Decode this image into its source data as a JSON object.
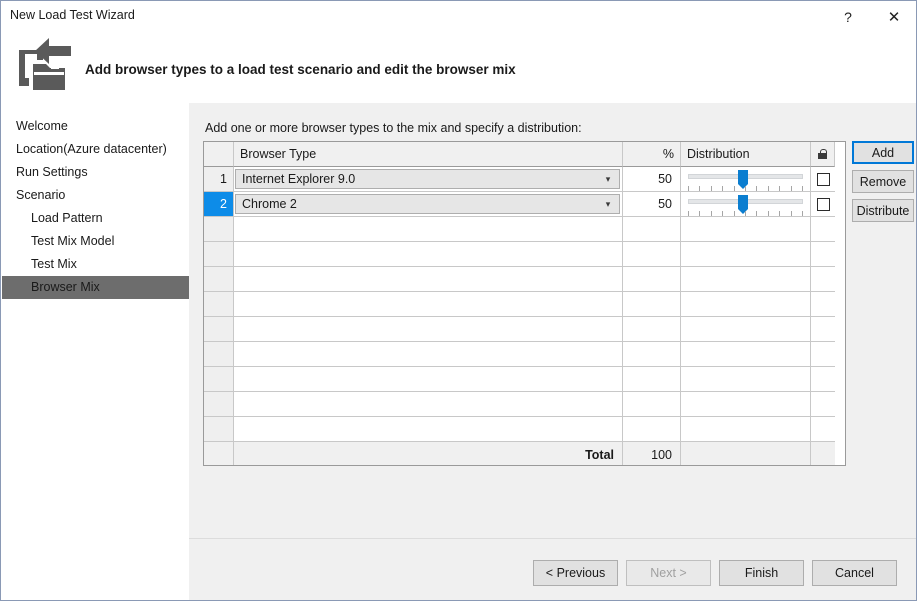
{
  "window": {
    "title": "New Load Test Wizard",
    "help_label": "?",
    "close_label": "✕"
  },
  "header": {
    "title": "Add browser types to a load test scenario and edit the browser mix",
    "icon": "import-folder-icon"
  },
  "sidebar": {
    "items": [
      {
        "label": "Welcome",
        "level": 0,
        "selected": false
      },
      {
        "label": "Location(Azure datacenter)",
        "level": 0,
        "selected": false
      },
      {
        "label": "Run Settings",
        "level": 0,
        "selected": false
      },
      {
        "label": "Scenario",
        "level": 0,
        "selected": false
      },
      {
        "label": "Load Pattern",
        "level": 1,
        "selected": false
      },
      {
        "label": "Test Mix Model",
        "level": 1,
        "selected": false
      },
      {
        "label": "Test Mix",
        "level": 1,
        "selected": false
      },
      {
        "label": "Browser Mix",
        "level": 1,
        "selected": true
      }
    ]
  },
  "main": {
    "instruction": "Add one or more browser types to the mix and specify a distribution:",
    "grid": {
      "columns": {
        "row_number": "",
        "browser_type": "Browser Type",
        "percent": "%",
        "distribution": "Distribution",
        "lock": "lock-icon"
      },
      "rows": [
        {
          "number": "1",
          "browser_type": "Internet Explorer 9.0",
          "percent": "50",
          "distribution": 50,
          "locked": false,
          "selected": false
        },
        {
          "number": "2",
          "browser_type": "Chrome 2",
          "percent": "50",
          "distribution": 50,
          "locked": false,
          "selected": true
        }
      ],
      "empty_row_count": 9,
      "total": {
        "label": "Total",
        "percent": "100"
      }
    },
    "actions": {
      "add": "Add",
      "remove": "Remove",
      "distribute": "Distribute"
    }
  },
  "footer": {
    "previous": "< Previous",
    "next": "Next >",
    "finish": "Finish",
    "cancel": "Cancel"
  },
  "colors": {
    "accent": "#0078d7",
    "selected_row": "#0d8ce8",
    "sidebar_selected": "#6d6d6d",
    "slider_thumb": "#0b7ed0",
    "panel_bg": "#f0f0f0"
  }
}
